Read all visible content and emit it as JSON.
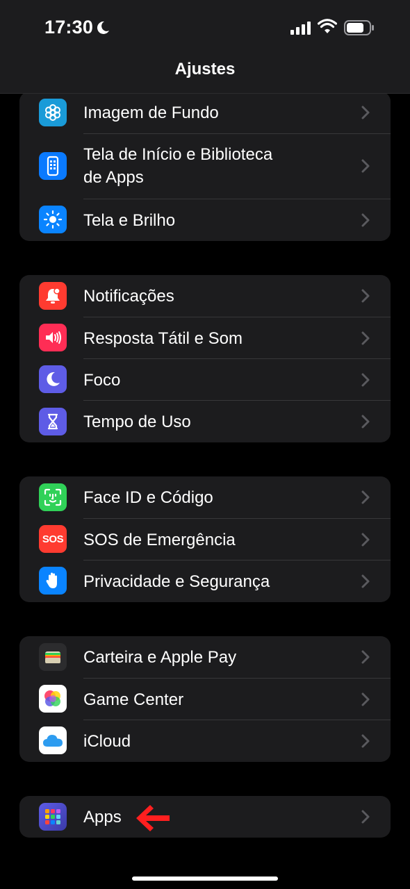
{
  "status_bar": {
    "time": "17:30"
  },
  "nav": {
    "title": "Ajustes"
  },
  "groups": [
    {
      "items": [
        {
          "label": "Imagem de Fundo",
          "icon": "wallpaper-icon",
          "color": "#1a9bd8"
        },
        {
          "label_line1": "Tela de Início e Biblioteca",
          "label_line2": "de Apps",
          "icon": "home-screen-icon",
          "color": "#0a7aff"
        },
        {
          "label": "Tela e Brilho",
          "icon": "brightness-icon",
          "color": "#0a84ff"
        }
      ]
    },
    {
      "items": [
        {
          "label": "Notificações",
          "icon": "notifications-icon",
          "color": "#ff3b30"
        },
        {
          "label": "Resposta Tátil e Som",
          "icon": "sound-icon",
          "color": "#ff2d55"
        },
        {
          "label": "Foco",
          "icon": "focus-moon-icon",
          "color": "#5e5ce6"
        },
        {
          "label": "Tempo de Uso",
          "icon": "hourglass-icon",
          "color": "#5e5ce6"
        }
      ]
    },
    {
      "items": [
        {
          "label": "Face ID e Código",
          "icon": "face-id-icon",
          "color": "#30d158"
        },
        {
          "label": "SOS de Emergência",
          "icon": "sos-icon",
          "icon_text": "SOS",
          "color": "#ff3b30"
        },
        {
          "label": "Privacidade e Segurança",
          "icon": "privacy-hand-icon",
          "color": "#0a84ff"
        }
      ]
    },
    {
      "items": [
        {
          "label": "Carteira e Apple Pay",
          "icon": "wallet-icon",
          "color": "#2c2c2e"
        },
        {
          "label": "Game Center",
          "icon": "game-center-icon",
          "color": "#ffffff"
        },
        {
          "label": "iCloud",
          "icon": "icloud-icon",
          "color": "#ffffff"
        }
      ]
    },
    {
      "items": [
        {
          "label": "Apps",
          "icon": "apps-grid-icon",
          "color": "#5e5ce6"
        }
      ]
    }
  ],
  "annotation": {
    "arrow_icon": "red-arrow-icon",
    "arrow_color": "#ff1f1f"
  }
}
